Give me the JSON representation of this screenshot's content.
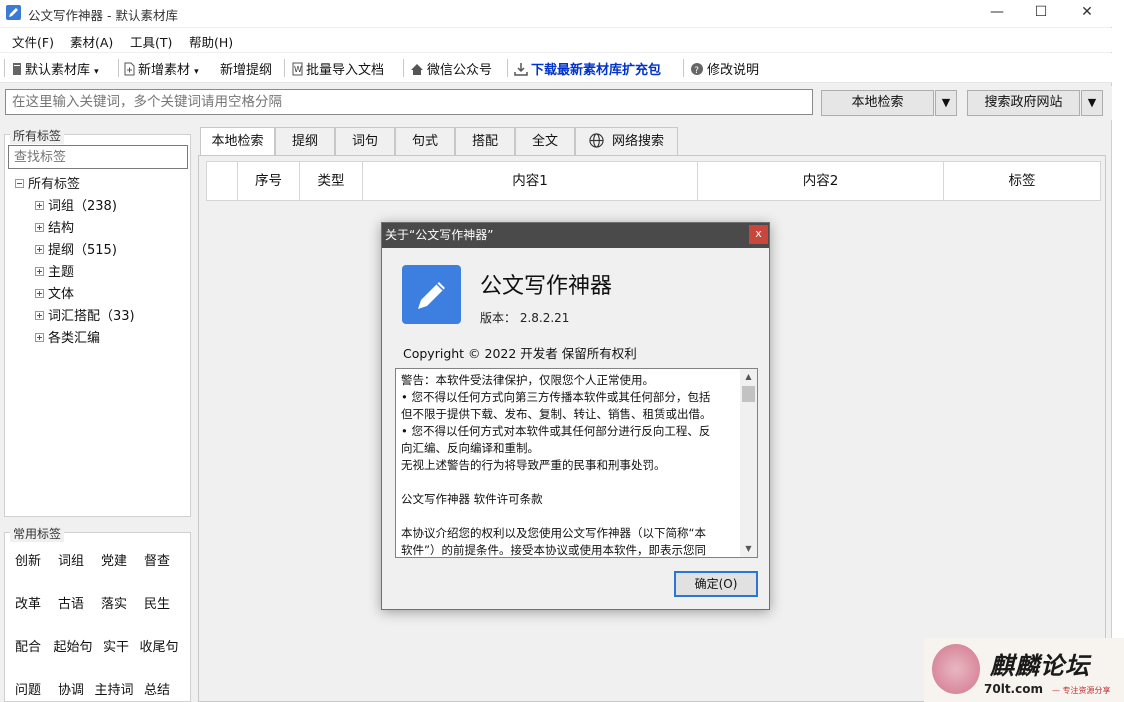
{
  "window": {
    "title": "公文写作神器  -  默认素材库",
    "minimize": "—",
    "maximize": "☐",
    "close": "✕"
  },
  "menu": [
    "文件(F)",
    "素材(A)",
    "工具(T)",
    "帮助(H)"
  ],
  "toolbar": {
    "library": "默认素材库",
    "add_material": "新增素材",
    "add_outline": "新增提纲",
    "batch_import": "批量导入文档",
    "wechat": "微信公众号",
    "download": "下载最新素材库扩充包",
    "changelog": "修改说明"
  },
  "search": {
    "placeholder": "在这里输入关键词，多个关键词请用空格分隔",
    "local_button": "本地检索",
    "gov_button": "搜索政府网站",
    "dropdown_glyph": "▼"
  },
  "all_tags": {
    "group_label": "所有标签",
    "search_placeholder": "查找标签",
    "root": "所有标签",
    "items": [
      {
        "label": "词组（238)"
      },
      {
        "label": "结构"
      },
      {
        "label": "提纲（515)"
      },
      {
        "label": "主题"
      },
      {
        "label": "文体"
      },
      {
        "label": "词汇搭配（33)"
      },
      {
        "label": "各类汇编"
      }
    ]
  },
  "common_tags": {
    "group_label": "常用标签",
    "rows": [
      [
        "创新",
        "词组",
        "党建",
        "督查"
      ],
      [
        "改革",
        "古语",
        "落实",
        "民生"
      ],
      [
        "配合",
        "起始句",
        "实干",
        "收尾句"
      ],
      [
        "问题",
        "协调",
        "主持词",
        "总结"
      ]
    ]
  },
  "tabs": [
    "本地检索",
    "提纲",
    "词句",
    "句式",
    "搭配",
    "全文",
    "网络搜索"
  ],
  "grid": {
    "columns": [
      "",
      "序号",
      "类型",
      "内容1",
      "内容2",
      "标签"
    ]
  },
  "about_dialog": {
    "title": "关于“公文写作神器”",
    "close": "x",
    "app_name": "公文写作神器",
    "version": "版本：  2.8.2.21",
    "copyright": "Copyright © 2022  开发者 保留所有权利",
    "text_lines": [
      "警告：本软件受法律保护，仅限您个人正常使用。",
      "•  您不得以任何方式向第三方传播本软件或其任何部分，包括",
      "但不限于提供下载、发布、复制、转让、销售、租赁或出借。",
      "•  您不得以任何方式对本软件或其任何部分进行反向工程、反",
      "向汇编、反向编译和重制。",
      "无视上述警告的行为将导致严重的民事和刑事处罚。",
      "",
      "公文写作神器 软件许可条款",
      "",
      "本协议介绍您的权利以及您使用公文写作神器（以下简称“本",
      "软件”）的前提条件。接受本协议或使用本软件，即表示您同"
    ],
    "ok_button": "确定(O)",
    "scroll_up": "▲",
    "scroll_down": "▼"
  },
  "watermark": {
    "title": "麒麟论坛",
    "url": "70lt.com",
    "slogan": "— 专注资源分享"
  }
}
